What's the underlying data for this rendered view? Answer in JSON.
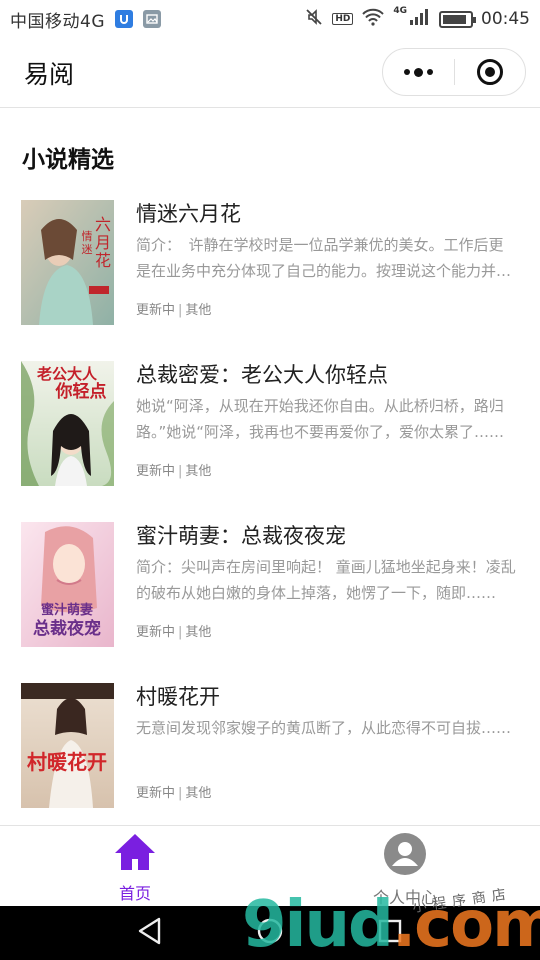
{
  "status_bar": {
    "carrier": "中国移动4G",
    "hd": "HD",
    "network": "4G",
    "battery_level": 0.9,
    "time": "00:45"
  },
  "nav": {
    "title": "易阅"
  },
  "section": {
    "title": "小说精选"
  },
  "books": [
    {
      "title": "情迷六月花",
      "desc": "简介：　许静在学校时是一位品学兼优的美女。工作后更是在业务中充分体现了自己的能力。按理说这个能力并不是那么的简单……",
      "status": "更新中",
      "category": "其他",
      "cover_text": "情迷六月花",
      "cover_colors": [
        "#c8b9a6",
        "#7fa8a0"
      ]
    },
    {
      "title": "总裁密爱：老公大人你轻点",
      "desc": "她说“阿泽，从现在开始我还你自由。从此桥归桥，路归路。”她说“阿泽，我再也不要再爱你了，爱你太累了……",
      "status": "更新中",
      "category": "其他",
      "cover_text": "老公大人你轻点",
      "cover_colors": [
        "#e8eee0",
        "#5a8a4a"
      ]
    },
    {
      "title": "蜜汁萌妻：总裁夜夜宠",
      "desc": "简介：尖叫声在房间里响起！ 童画儿猛地坐起身来！凌乱的破布从她白嫩的身体上掉落，她愣了一下，随即……",
      "status": "更新中",
      "category": "其他",
      "cover_text": "总裁夜夜宠",
      "cover_colors": [
        "#f6d9e4",
        "#b35a86"
      ]
    },
    {
      "title": "村暖花开",
      "desc": "无意间发现邻家嫂子的黄瓜断了，从此恋得不可自拔……",
      "status": "更新中",
      "category": "其他",
      "cover_text": "村暖花开",
      "cover_colors": [
        "#e7d6c4",
        "#c23a2a"
      ]
    }
  ],
  "tabs": [
    {
      "label": "首页",
      "icon": "home-icon",
      "active": true
    },
    {
      "label": "个人中心",
      "icon": "user-icon",
      "active": false
    }
  ],
  "colors": {
    "accent": "#7a1fe0",
    "muted": "#999999"
  },
  "watermark": {
    "brand": "9iud",
    "dot": ".",
    "tld": "com",
    "tagline": "小程序商店"
  }
}
